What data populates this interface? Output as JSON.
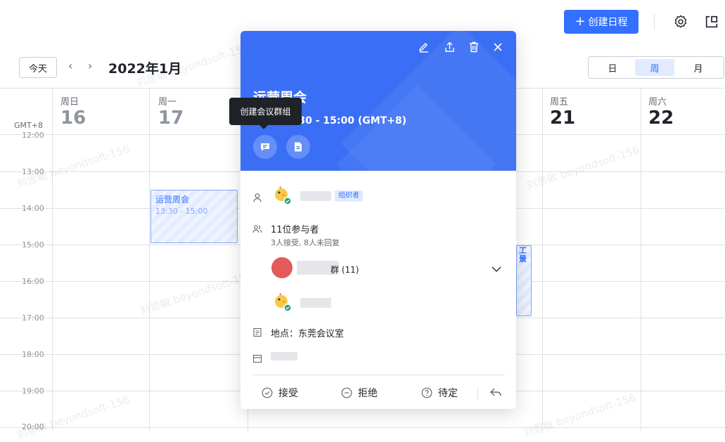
{
  "topbar": {
    "create_label": "创建日程"
  },
  "nav": {
    "today_label": "今天",
    "prev": "‹",
    "next": "›",
    "month_title": "2022年1月"
  },
  "view_switch": {
    "day": "日",
    "week": "周",
    "month": "月",
    "selected": "周"
  },
  "timezone": "GMT+8",
  "days": [
    {
      "name": "周日",
      "num": "16"
    },
    {
      "name": "周一",
      "num": "17"
    },
    {
      "name": "周五",
      "num": "21"
    },
    {
      "name": "周六",
      "num": "22"
    }
  ],
  "times": [
    "12:00",
    "13:00",
    "14:00",
    "15:00",
    "16:00",
    "17:00",
    "18:00",
    "19:00",
    "20:00"
  ],
  "events": [
    {
      "title": "运营周会",
      "time": "13:30 - 15:00"
    },
    {
      "title": "工\n景"
    }
  ],
  "popover": {
    "title": "运营周会",
    "time": "周一) 13:30 - 15:00 (GMT+8)",
    "organizer_badge": "组织者",
    "attendee_count": "11位参与者",
    "attendee_status": "3人接受, 8人未回复",
    "group_label": "群 (11)",
    "location": "地点：东莞会议室",
    "actions": {
      "accept": "接受",
      "decline": "拒绝",
      "tentative": "待定"
    }
  },
  "tooltip": "创建会议群组",
  "watermark": "刘思敏 beyondsoft-156",
  "colors": {
    "accent": "#3370ff",
    "header_blue": "#3a6ff5"
  }
}
